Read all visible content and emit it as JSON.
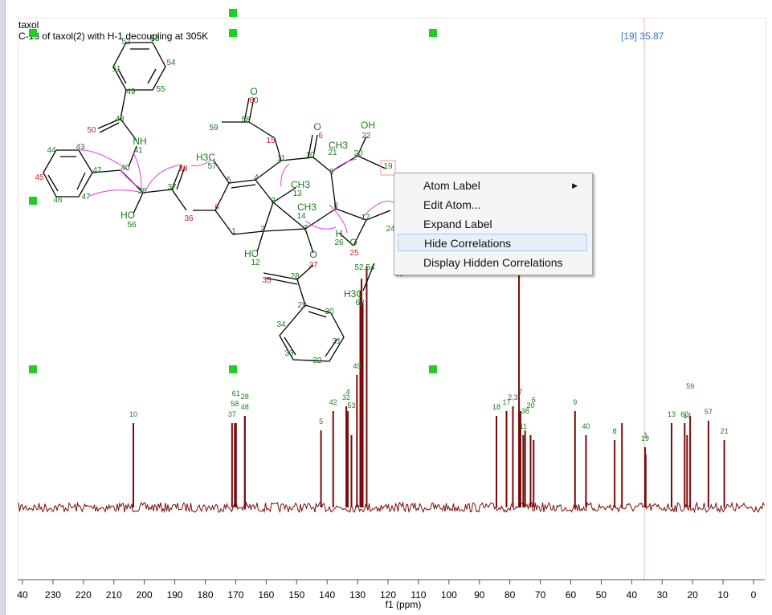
{
  "window": {
    "title": "taxol",
    "subtitle": "C-13 of taxol(2) with H-1 decoupling at 305K",
    "cursor_readout": "[19] 35.87"
  },
  "context_menu": {
    "items": [
      {
        "label": "Atom Label",
        "has_submenu": true
      },
      {
        "label": "Edit Atom...",
        "has_submenu": false
      },
      {
        "label": "Expand Label",
        "has_submenu": false
      },
      {
        "label": "Hide Correlations",
        "has_submenu": false,
        "highlighted": true
      },
      {
        "label": "Display Hidden Correlations",
        "has_submenu": false
      }
    ]
  },
  "colors": {
    "spectrum": "#7a0a0a",
    "atom_label": "#1a7a1a",
    "hetero_label": "#cc2222",
    "correlation": "#e040e0",
    "handle": "#22cc22",
    "cursor_line": "#f2b8b8",
    "readout": "#2f78c6"
  },
  "chart_data": {
    "type": "line",
    "title": "C-13 of taxol(2) with H-1 decoupling at 305K",
    "xlabel": "f1 (ppm)",
    "x_reversed": true,
    "xlim": [
      240,
      0
    ],
    "x_ticks": [
      "40",
      "230",
      "220",
      "210",
      "200",
      "190",
      "180",
      "170",
      "160",
      "150",
      "140",
      "130",
      "120",
      "110",
      "100",
      "90",
      "80",
      "70",
      "60",
      "50",
      "40",
      "30",
      "20",
      "10",
      "0"
    ],
    "cursor_ppm": 35.87,
    "peaks": [
      {
        "ppm": 203.6,
        "height": 0.35,
        "label": "10"
      },
      {
        "ppm": 171.2,
        "height": 0.35,
        "label": "37"
      },
      {
        "ppm": 170.3,
        "height": 0.35,
        "label": "58"
      },
      {
        "ppm": 169.9,
        "height": 0.35,
        "label": "61"
      },
      {
        "ppm": 167.0,
        "height": 0.38,
        "label": "48"
      },
      {
        "ppm": 167.0,
        "height": 0.38,
        "label": "28"
      },
      {
        "ppm": 142.0,
        "height": 0.32,
        "label": "5"
      },
      {
        "ppm": 138.0,
        "height": 0.4,
        "label": "42"
      },
      {
        "ppm": 133.7,
        "height": 0.42,
        "label": "32"
      },
      {
        "ppm": 133.2,
        "height": 0.4,
        "label": "4"
      },
      {
        "ppm": 132.0,
        "height": 0.3,
        "label": "53"
      },
      {
        "ppm": 130.2,
        "height": 0.55,
        "label": "49"
      },
      {
        "ppm": 129.1,
        "height": 0.9,
        "label": ""
      },
      {
        "ppm": 128.7,
        "height": 0.95,
        "label": ""
      },
      {
        "ppm": 128.3,
        "height": 0.85,
        "label": ""
      },
      {
        "ppm": 127.0,
        "height": 1.0,
        "label": ""
      },
      {
        "ppm": 84.4,
        "height": 0.38,
        "label": "18"
      },
      {
        "ppm": 81.1,
        "height": 0.4,
        "label": "17"
      },
      {
        "ppm": 79.0,
        "height": 0.42,
        "label": "2,3"
      },
      {
        "ppm": 77.0,
        "height": 1.0,
        "label": ""
      },
      {
        "ppm": 76.5,
        "height": 0.4,
        "label": "7"
      },
      {
        "ppm": 75.6,
        "height": 0.3,
        "label": "11"
      },
      {
        "ppm": 75.0,
        "height": 0.32,
        "label": "38"
      },
      {
        "ppm": 73.2,
        "height": 0.3,
        "label": "20"
      },
      {
        "ppm": 72.2,
        "height": 0.28,
        "label": "6"
      },
      {
        "ppm": 58.6,
        "height": 0.4,
        "label": "9"
      },
      {
        "ppm": 55.0,
        "height": 0.3,
        "label": "40"
      },
      {
        "ppm": 45.6,
        "height": 0.28,
        "label": "8"
      },
      {
        "ppm": 43.2,
        "height": 0.35,
        "label": ""
      },
      {
        "ppm": 35.6,
        "height": 0.25,
        "label": "19"
      },
      {
        "ppm": 35.4,
        "height": 0.22,
        "label": "1"
      },
      {
        "ppm": 26.9,
        "height": 0.35,
        "label": "13"
      },
      {
        "ppm": 22.6,
        "height": 0.35,
        "label": "62"
      },
      {
        "ppm": 21.8,
        "height": 0.3,
        "label": "14"
      },
      {
        "ppm": 20.8,
        "height": 0.38,
        "label": "59"
      },
      {
        "ppm": 14.8,
        "height": 0.36,
        "label": "57"
      },
      {
        "ppm": 9.6,
        "height": 0.28,
        "label": "21"
      }
    ]
  },
  "structure": {
    "atom_labels": [
      "52",
      "53",
      "54",
      "51",
      "55",
      "49",
      "48",
      "50",
      "NH",
      "41",
      "43",
      "44",
      "42",
      "40",
      "39",
      "45",
      "46",
      "47",
      "38",
      "37",
      "HO",
      "56",
      "36",
      "H3C",
      "57",
      "59",
      "58",
      "O",
      "60",
      "15",
      "11",
      "10",
      "O",
      "6",
      "5",
      "4",
      "3",
      "13",
      "CH3",
      "14",
      "CH3",
      "6",
      "1",
      "2",
      "7",
      "HO",
      "12",
      "O",
      "27",
      "35",
      "28",
      "29",
      "30",
      "34",
      "31",
      "33",
      "32",
      "OH",
      "22",
      "20",
      "CH3",
      "21",
      "9",
      "19",
      "8",
      "17",
      "H",
      "26",
      "O",
      "25",
      "24",
      "52,54",
      "63",
      "H3C",
      "62"
    ]
  }
}
